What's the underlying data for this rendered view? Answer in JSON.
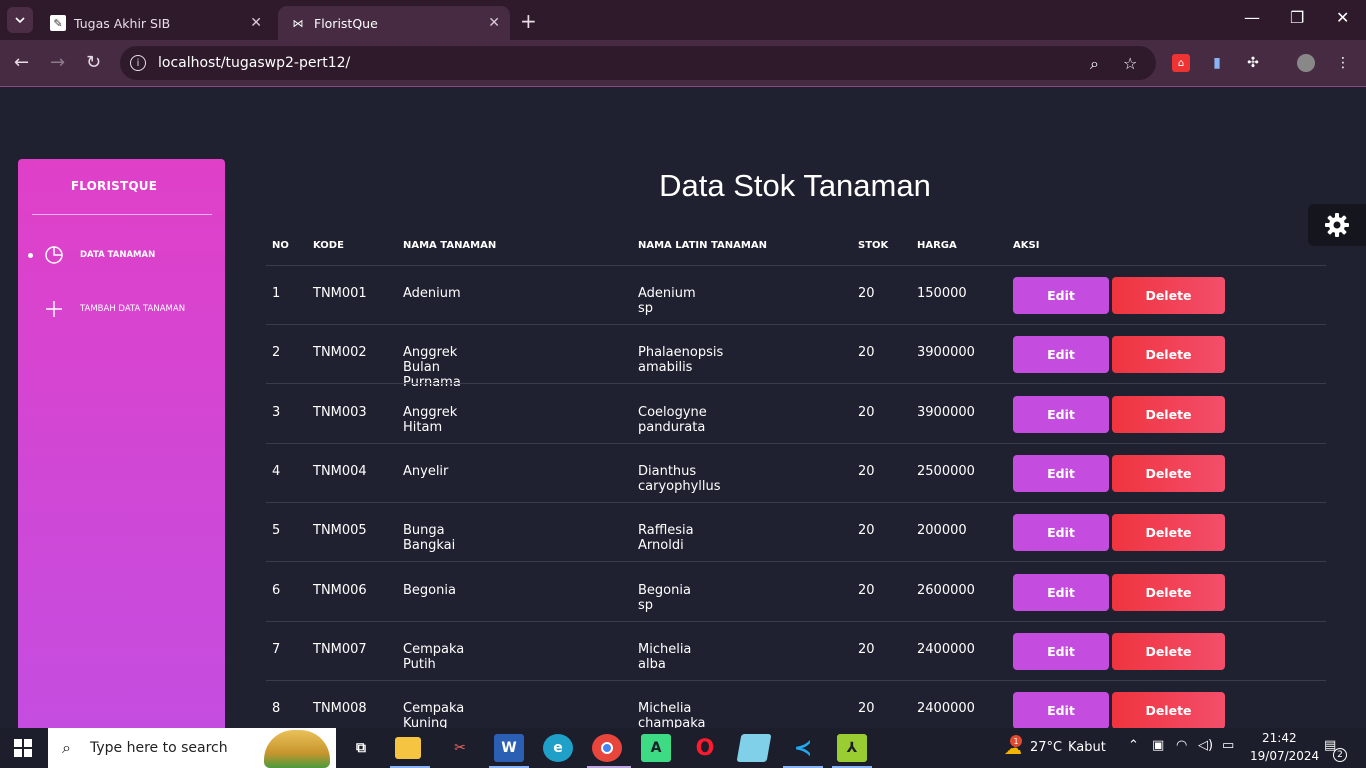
{
  "browser": {
    "tabs": [
      {
        "title": "Tugas Akhir SIB",
        "active": false
      },
      {
        "title": "FloristQue",
        "active": true
      }
    ],
    "url": "localhost/tugaswp2-pert12/"
  },
  "sidebar": {
    "brand": "FLORISTQUE",
    "items": [
      {
        "label": "DATA TANAMAN",
        "icon": "pie-chart-icon",
        "active": true
      },
      {
        "label": "TAMBAH DATA TANAMAN",
        "icon": "plus-icon",
        "active": false
      }
    ]
  },
  "main": {
    "title": "Data Stok Tanaman",
    "columns": [
      "NO",
      "KODE",
      "NAMA TANAMAN",
      "NAMA LATIN TANAMAN",
      "STOK",
      "HARGA",
      "AKSI"
    ],
    "edit_label": "Edit",
    "delete_label": "Delete",
    "rows": [
      {
        "no": "1",
        "kode": "TNM001",
        "nama": "Adenium",
        "latin": "Adenium sp",
        "stok": "20",
        "harga": "150000"
      },
      {
        "no": "2",
        "kode": "TNM002",
        "nama": "Anggrek Bulan Purnama",
        "latin": "Phalaenopsis amabilis",
        "stok": "20",
        "harga": "3900000"
      },
      {
        "no": "3",
        "kode": "TNM003",
        "nama": "Anggrek Hitam",
        "latin": "Coelogyne pandurata",
        "stok": "20",
        "harga": "3900000"
      },
      {
        "no": "4",
        "kode": "TNM004",
        "nama": "Anyelir",
        "latin": "Dianthus caryophyllus",
        "stok": "20",
        "harga": "2500000"
      },
      {
        "no": "5",
        "kode": "TNM005",
        "nama": "Bunga Bangkai",
        "latin": "Rafflesia Arnoldi",
        "stok": "20",
        "harga": "200000"
      },
      {
        "no": "6",
        "kode": "TNM006",
        "nama": "Begonia",
        "latin": "Begonia sp",
        "stok": "20",
        "harga": "2600000"
      },
      {
        "no": "7",
        "kode": "TNM007",
        "nama": "Cempaka Putih",
        "latin": "Michelia alba",
        "stok": "20",
        "harga": "2400000"
      },
      {
        "no": "8",
        "kode": "TNM008",
        "nama": "Cempaka Kuning",
        "latin": "Michelia champaka",
        "stok": "20",
        "harga": "2400000"
      }
    ]
  },
  "taskbar": {
    "search_placeholder": "Type here to search",
    "weather_temp": "27°C",
    "weather_desc": "Kabut",
    "weather_badge": "1",
    "time": "21:42",
    "date": "19/07/2024",
    "notification_count": "2"
  },
  "colors": {
    "accent": "#c44de0",
    "sidebar_top": "#e040c8",
    "delete": "#f0343f",
    "background": "#202130"
  }
}
